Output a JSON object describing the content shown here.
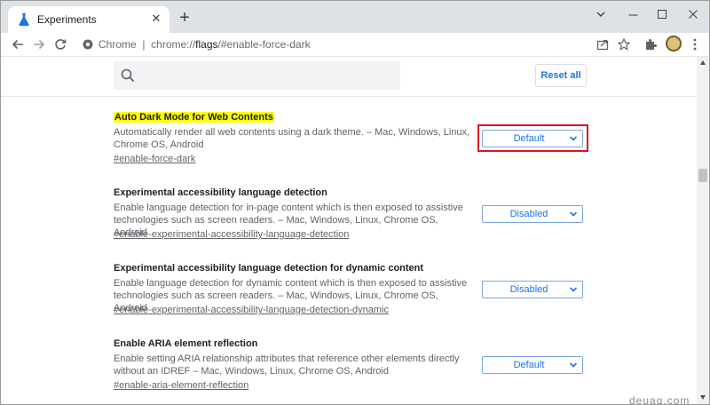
{
  "browser": {
    "tab_title": "Experiments",
    "new_tab_symbol": "+",
    "url_prefix": "Chrome",
    "url_separator": "|",
    "url_scheme": "chrome://",
    "url_host": "flags",
    "url_path": "/#enable-force-dark"
  },
  "header": {
    "search_placeholder": "",
    "reset_label": "Reset all"
  },
  "flags": [
    {
      "title": "Auto Dark Mode for Web Contents",
      "description": "Automatically render all web contents using a dark theme. – Mac, Windows, Linux, Chrome OS, Android",
      "link": "#enable-force-dark",
      "value": "Default"
    },
    {
      "title": "Experimental accessibility language detection",
      "description": "Enable language detection for in-page content which is then exposed to assistive technologies such as screen readers. – Mac, Windows, Linux, Chrome OS, Android",
      "link": "#enable-experimental-accessibility-language-detection",
      "value": "Disabled"
    },
    {
      "title": "Experimental accessibility language detection for dynamic content",
      "description": "Enable language detection for dynamic content which is then exposed to assistive technologies such as screen readers. – Mac, Windows, Linux, Chrome OS, Android",
      "link": "#enable-experimental-accessibility-language-detection-dynamic",
      "value": "Disabled"
    },
    {
      "title": "Enable ARIA element reflection",
      "description": "Enable setting ARIA relationship attributes that reference other elements directly without an IDREF – Mac, Windows, Linux, Chrome OS, Android",
      "link": "#enable-aria-element-reflection",
      "value": "Default"
    }
  ],
  "watermark": "deuaq.com",
  "colors": {
    "accent": "#1a73e8",
    "highlight": "#ffff00",
    "annotation": "#e0141f"
  }
}
